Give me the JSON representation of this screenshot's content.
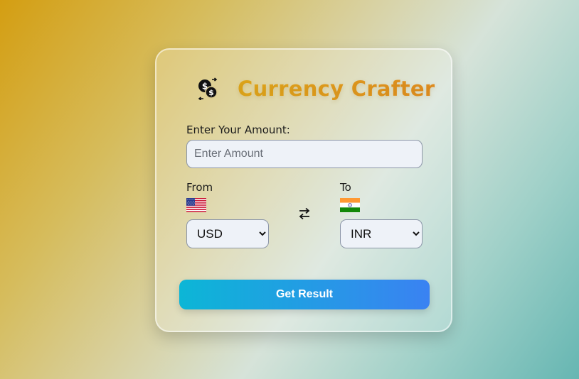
{
  "header": {
    "title": "Currency Crafter",
    "logo_icon": "currency-exchange-icon",
    "title_colors": [
      "#e0a81a",
      "#e28d20"
    ]
  },
  "amount": {
    "label": "Enter Your Amount:",
    "placeholder": "Enter Amount",
    "value": ""
  },
  "from": {
    "label": "From",
    "flag": "us-flag-icon",
    "selected": "USD"
  },
  "to": {
    "label": "To",
    "flag": "india-flag-icon",
    "selected": "INR"
  },
  "swap_icon": "swap-arrows-icon",
  "submit": {
    "label": "Get Result",
    "colors": [
      "#0cb6d6",
      "#3a82f2"
    ]
  }
}
